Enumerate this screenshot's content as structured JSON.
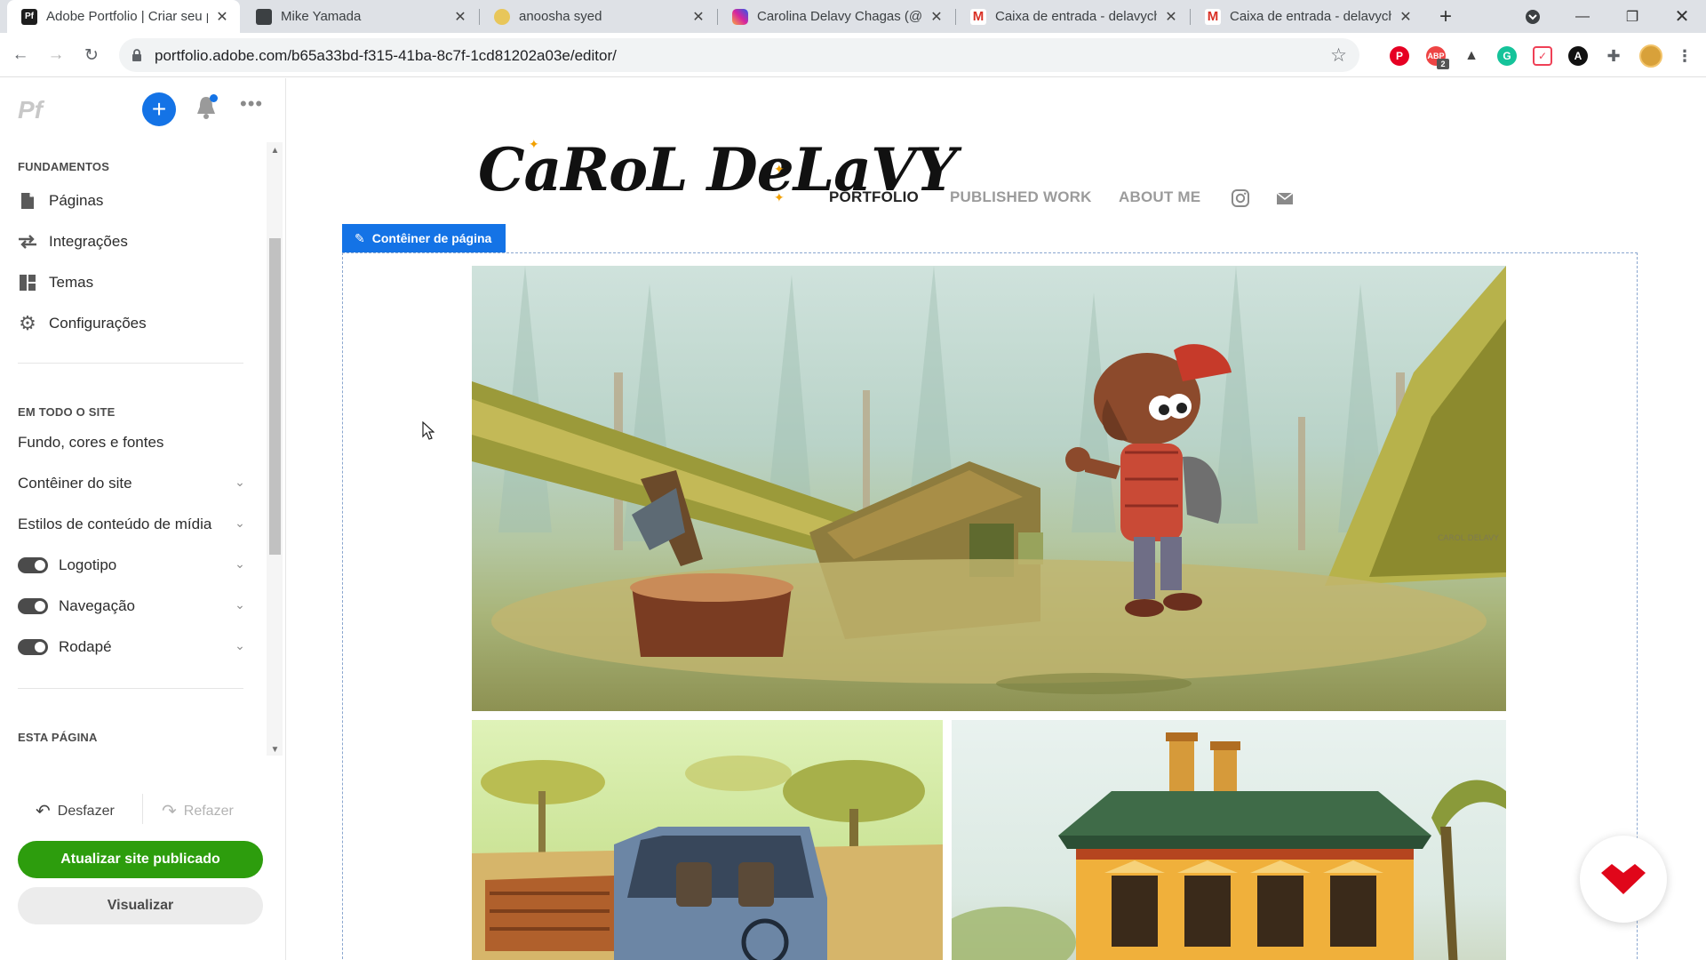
{
  "browser": {
    "tabs": [
      {
        "title": "Adobe Portfolio | Criar seu p",
        "favicon": "pf-icon",
        "active": true
      },
      {
        "title": "Mike Yamada",
        "favicon": "cube-icon",
        "active": false
      },
      {
        "title": "anoosha syed",
        "favicon": "character-icon",
        "active": false
      },
      {
        "title": "Carolina Delavy Chagas (@c",
        "favicon": "instagram-icon",
        "active": false
      },
      {
        "title": "Caixa de entrada - delavych",
        "favicon": "gmail-icon",
        "active": false
      },
      {
        "title": "Caixa de entrada - delavych",
        "favicon": "gmail-icon",
        "active": false
      }
    ],
    "url": "portfolio.adobe.com/b65a33bd-f315-41ba-8c7f-1cd81202a03e/editor/",
    "pf_favicon_text": "Pf",
    "abp_badge": "2"
  },
  "panel": {
    "logo": "Pf",
    "fundamentos_header": "FUNDAMENTOS",
    "fundamentos": [
      {
        "label": "Páginas",
        "icon": "pages-icon"
      },
      {
        "label": "Integrações",
        "icon": "integrations-icon"
      },
      {
        "label": "Temas",
        "icon": "themes-icon"
      },
      {
        "label": "Configurações",
        "icon": "gear-icon"
      }
    ],
    "site_header": "EM TODO O SITE",
    "site_items": [
      {
        "label": "Fundo, cores e fontes",
        "chevron": false,
        "toggle": false
      },
      {
        "label": "Contêiner do site",
        "chevron": true,
        "toggle": false
      },
      {
        "label": "Estilos de conteúdo de mídia",
        "chevron": true,
        "toggle": false
      },
      {
        "label": "Logotipo",
        "chevron": true,
        "toggle": true
      },
      {
        "label": "Navegação",
        "chevron": true,
        "toggle": true
      },
      {
        "label": "Rodapé",
        "chevron": true,
        "toggle": true
      }
    ],
    "page_header": "ESTA PÁGINA",
    "undo": "Desfazer",
    "redo": "Refazer",
    "update_button": "Atualizar site publicado",
    "preview_button": "Visualizar"
  },
  "site": {
    "logo_text": "CaRoL DeLaVY",
    "nav": [
      {
        "label": "PORTFOLIO",
        "active": true
      },
      {
        "label": "PUBLISHED WORK",
        "active": false
      },
      {
        "label": "ABOUT ME",
        "active": false
      }
    ],
    "nav_icons": [
      "instagram-icon",
      "mail-icon"
    ],
    "container_tag": "Contêiner de página",
    "artwork_signature": "CAROL DELAVY"
  },
  "colors": {
    "accent_blue": "#1473e6",
    "update_green": "#2d9d0d",
    "behance_red": "#e0061a"
  }
}
